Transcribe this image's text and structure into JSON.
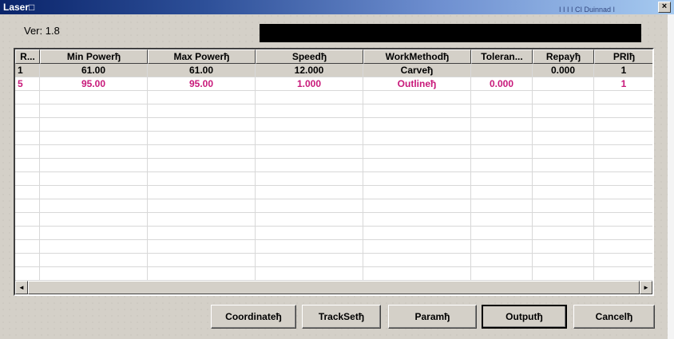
{
  "window": {
    "title": "Laser□",
    "title_right_ghost": "I I I I CI Duinnad I",
    "close_label": "×"
  },
  "version_label": "Ver: 1.8",
  "table": {
    "columns": [
      "R...",
      "Min Powerђ",
      "Max Powerђ",
      "Speedђ",
      "WorkMethodђ",
      "Toleran...",
      "Repayђ",
      "PRIђ"
    ],
    "rows": [
      {
        "cells": [
          "1",
          "61.00",
          "61.00",
          "12.000",
          "Carveђ",
          "",
          "0.000",
          "1"
        ],
        "selected": true,
        "color": "#000000"
      },
      {
        "cells": [
          "5",
          "95.00",
          "95.00",
          "1.000",
          "Outlineђ",
          "0.000",
          "",
          "1"
        ],
        "selected": false,
        "color": "#c8197a"
      }
    ],
    "empty_rows": 14
  },
  "scrollbar": {
    "left_arrow": "◄",
    "right_arrow": "►"
  },
  "buttons": {
    "coordinate": "Coordinateђ",
    "trackset": "TrackSetђ",
    "param": "Paramђ",
    "output": "Outputђ",
    "cancel": "Cancelђ"
  },
  "colors": {
    "title_start": "#0a246a",
    "title_end": "#a6caf0",
    "pink_row": "#c8197a",
    "dialog_bg": "#d4d0c8"
  }
}
